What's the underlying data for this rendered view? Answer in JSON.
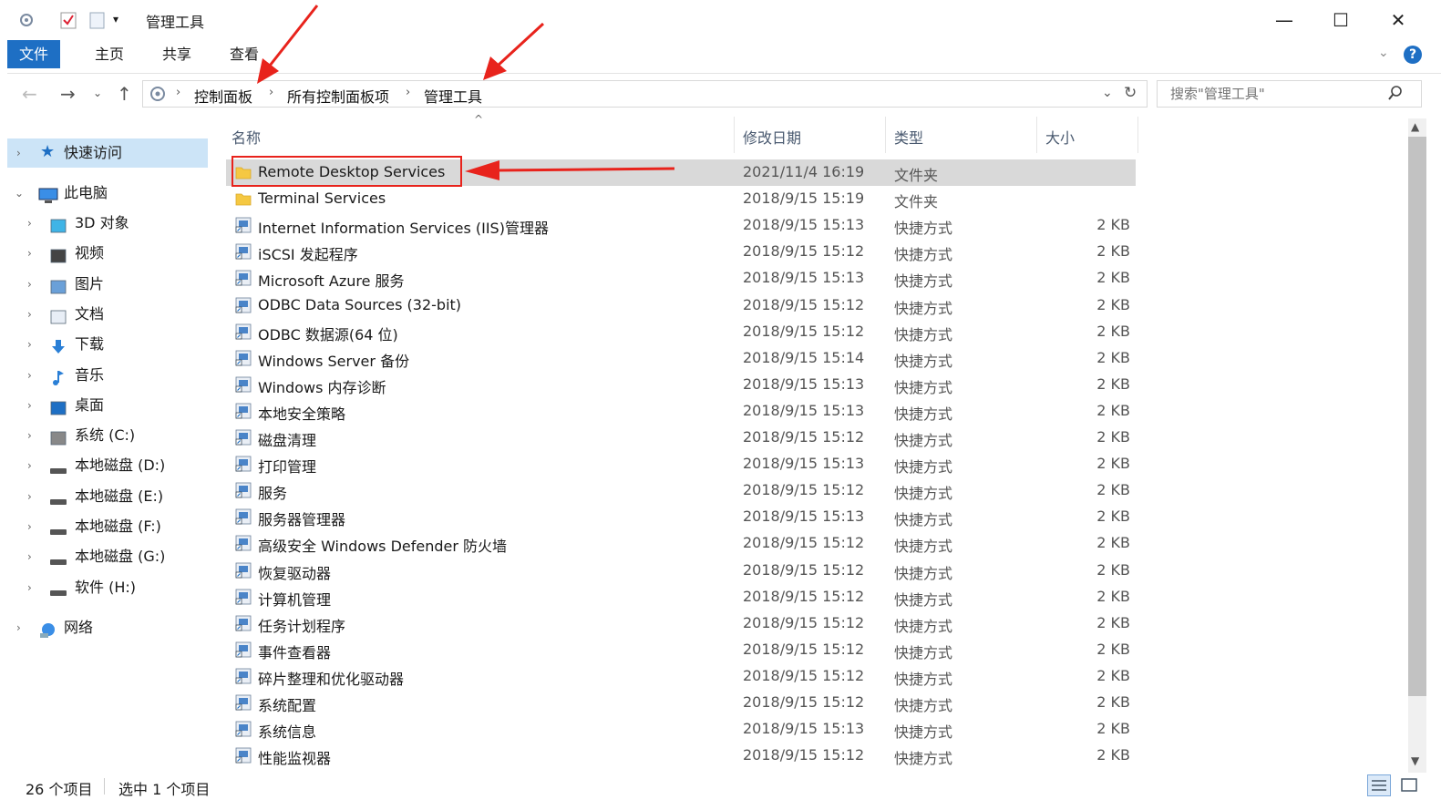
{
  "window": {
    "title": "管理工具",
    "minimize_symbol": "—",
    "maximize_symbol": "☐",
    "close_symbol": "✕"
  },
  "ribbon": {
    "tabs": [
      {
        "label": "文件"
      },
      {
        "label": "主页"
      },
      {
        "label": "共享"
      },
      {
        "label": "查看"
      }
    ]
  },
  "address": {
    "breadcrumbs": [
      "控制面板",
      "所有控制面板项",
      "管理工具"
    ]
  },
  "search": {
    "placeholder": "搜索\"管理工具\""
  },
  "navpane": {
    "quick_access": "快速访问",
    "this_pc": "此电脑",
    "items": [
      {
        "label": "3D 对象",
        "icon": "3d-objects-icon"
      },
      {
        "label": "视频",
        "icon": "videos-icon"
      },
      {
        "label": "图片",
        "icon": "pictures-icon"
      },
      {
        "label": "文档",
        "icon": "documents-icon"
      },
      {
        "label": "下载",
        "icon": "downloads-icon"
      },
      {
        "label": "音乐",
        "icon": "music-icon"
      },
      {
        "label": "桌面",
        "icon": "desktop-icon"
      },
      {
        "label": "系统 (C:)",
        "icon": "system-drive-icon"
      },
      {
        "label": "本地磁盘 (D:)",
        "icon": "drive-icon"
      },
      {
        "label": "本地磁盘 (E:)",
        "icon": "drive-icon"
      },
      {
        "label": "本地磁盘 (F:)",
        "icon": "drive-icon"
      },
      {
        "label": "本地磁盘 (G:)",
        "icon": "drive-icon"
      },
      {
        "label": "软件 (H:)",
        "icon": "drive-icon"
      }
    ],
    "network": "网络"
  },
  "columns": {
    "name": "名称",
    "date": "修改日期",
    "type": "类型",
    "size": "大小"
  },
  "files": [
    {
      "name": "Remote Desktop Services",
      "date": "2021/11/4 16:19",
      "type": "文件夹",
      "size": "",
      "kind": "folder"
    },
    {
      "name": "Terminal Services",
      "date": "2018/9/15 15:19",
      "type": "文件夹",
      "size": "",
      "kind": "folder"
    },
    {
      "name": "Internet Information Services (IIS)管理器",
      "date": "2018/9/15 15:13",
      "type": "快捷方式",
      "size": "2 KB",
      "kind": "shortcut"
    },
    {
      "name": "iSCSI 发起程序",
      "date": "2018/9/15 15:12",
      "type": "快捷方式",
      "size": "2 KB",
      "kind": "shortcut"
    },
    {
      "name": "Microsoft Azure 服务",
      "date": "2018/9/15 15:13",
      "type": "快捷方式",
      "size": "2 KB",
      "kind": "shortcut"
    },
    {
      "name": "ODBC Data Sources (32-bit)",
      "date": "2018/9/15 15:12",
      "type": "快捷方式",
      "size": "2 KB",
      "kind": "shortcut"
    },
    {
      "name": "ODBC 数据源(64 位)",
      "date": "2018/9/15 15:12",
      "type": "快捷方式",
      "size": "2 KB",
      "kind": "shortcut"
    },
    {
      "name": "Windows Server 备份",
      "date": "2018/9/15 15:14",
      "type": "快捷方式",
      "size": "2 KB",
      "kind": "shortcut"
    },
    {
      "name": "Windows 内存诊断",
      "date": "2018/9/15 15:13",
      "type": "快捷方式",
      "size": "2 KB",
      "kind": "shortcut"
    },
    {
      "name": "本地安全策略",
      "date": "2018/9/15 15:13",
      "type": "快捷方式",
      "size": "2 KB",
      "kind": "shortcut"
    },
    {
      "name": "磁盘清理",
      "date": "2018/9/15 15:12",
      "type": "快捷方式",
      "size": "2 KB",
      "kind": "shortcut"
    },
    {
      "name": "打印管理",
      "date": "2018/9/15 15:13",
      "type": "快捷方式",
      "size": "2 KB",
      "kind": "shortcut"
    },
    {
      "name": "服务",
      "date": "2018/9/15 15:12",
      "type": "快捷方式",
      "size": "2 KB",
      "kind": "shortcut"
    },
    {
      "name": "服务器管理器",
      "date": "2018/9/15 15:13",
      "type": "快捷方式",
      "size": "2 KB",
      "kind": "shortcut"
    },
    {
      "name": "高级安全 Windows Defender 防火墙",
      "date": "2018/9/15 15:12",
      "type": "快捷方式",
      "size": "2 KB",
      "kind": "shortcut"
    },
    {
      "name": "恢复驱动器",
      "date": "2018/9/15 15:12",
      "type": "快捷方式",
      "size": "2 KB",
      "kind": "shortcut"
    },
    {
      "name": "计算机管理",
      "date": "2018/9/15 15:12",
      "type": "快捷方式",
      "size": "2 KB",
      "kind": "shortcut"
    },
    {
      "name": "任务计划程序",
      "date": "2018/9/15 15:12",
      "type": "快捷方式",
      "size": "2 KB",
      "kind": "shortcut"
    },
    {
      "name": "事件查看器",
      "date": "2018/9/15 15:12",
      "type": "快捷方式",
      "size": "2 KB",
      "kind": "shortcut"
    },
    {
      "name": "碎片整理和优化驱动器",
      "date": "2018/9/15 15:12",
      "type": "快捷方式",
      "size": "2 KB",
      "kind": "shortcut"
    },
    {
      "name": "系统配置",
      "date": "2018/9/15 15:12",
      "type": "快捷方式",
      "size": "2 KB",
      "kind": "shortcut"
    },
    {
      "name": "系统信息",
      "date": "2018/9/15 15:13",
      "type": "快捷方式",
      "size": "2 KB",
      "kind": "shortcut"
    },
    {
      "name": "性能监视器",
      "date": "2018/9/15 15:12",
      "type": "快捷方式",
      "size": "2 KB",
      "kind": "shortcut"
    }
  ],
  "status": {
    "item_count": "26 个项目",
    "selected": "选中 1 个项目"
  },
  "colors": {
    "accent": "#1e6fc4",
    "selection": "#d9d9d9",
    "annotation_red": "#e8231c",
    "folder_yellow": "#f5c842"
  }
}
